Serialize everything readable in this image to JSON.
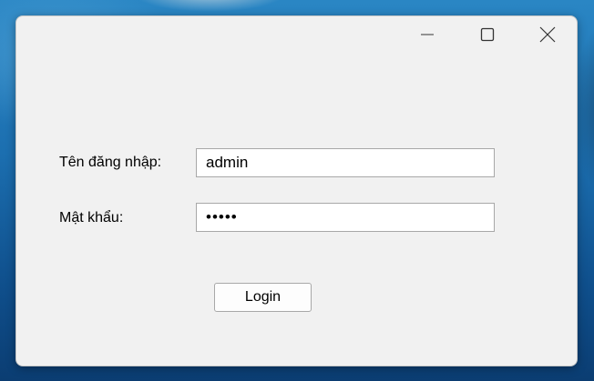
{
  "window": {
    "title": ""
  },
  "form": {
    "username_label": "Tên đăng nhập:",
    "username_value": "admin",
    "password_label": "Mật khẩu:",
    "password_value": "admin",
    "login_label": "Login"
  },
  "icons": {
    "minimize": "minimize-icon",
    "maximize": "maximize-icon",
    "close": "close-icon"
  },
  "colors": {
    "window_bg": "#f1f1f1",
    "desktop": "#1c6fb0"
  }
}
